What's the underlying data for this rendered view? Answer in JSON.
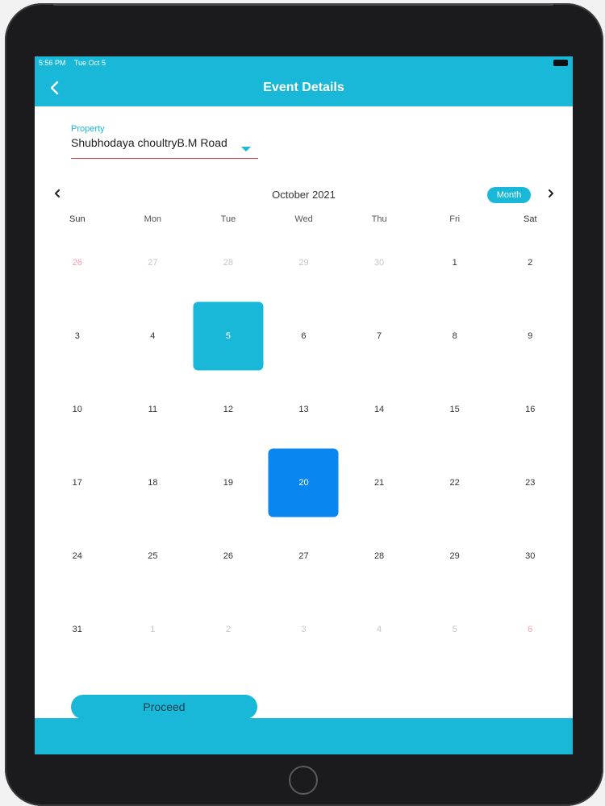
{
  "status_bar": {
    "time": "5:56 PM",
    "date": "Tue Oct 5"
  },
  "app_bar": {
    "title": "Event Details",
    "back_icon": "chevron-left-icon"
  },
  "property": {
    "label": "Property",
    "value": "Shubhodaya choultryB.M Road"
  },
  "calendar": {
    "month_label": "October 2021",
    "view_mode_label": "Month",
    "weekdays": [
      "Sun",
      "Mon",
      "Tue",
      "Wed",
      "Thu",
      "Fri",
      "Sat"
    ],
    "days": [
      {
        "d": "26",
        "outside": true,
        "red": true
      },
      {
        "d": "27",
        "outside": true
      },
      {
        "d": "28",
        "outside": true
      },
      {
        "d": "29",
        "outside": true
      },
      {
        "d": "30",
        "outside": true
      },
      {
        "d": "1"
      },
      {
        "d": "2"
      },
      {
        "d": "3"
      },
      {
        "d": "4"
      },
      {
        "d": "5",
        "today": true
      },
      {
        "d": "6"
      },
      {
        "d": "7"
      },
      {
        "d": "8"
      },
      {
        "d": "9"
      },
      {
        "d": "10"
      },
      {
        "d": "11"
      },
      {
        "d": "12"
      },
      {
        "d": "13"
      },
      {
        "d": "14"
      },
      {
        "d": "15"
      },
      {
        "d": "16"
      },
      {
        "d": "17"
      },
      {
        "d": "18"
      },
      {
        "d": "19"
      },
      {
        "d": "20",
        "selected": true
      },
      {
        "d": "21"
      },
      {
        "d": "22"
      },
      {
        "d": "23"
      },
      {
        "d": "24"
      },
      {
        "d": "25"
      },
      {
        "d": "26"
      },
      {
        "d": "27"
      },
      {
        "d": "28"
      },
      {
        "d": "29"
      },
      {
        "d": "30"
      },
      {
        "d": "31"
      },
      {
        "d": "1",
        "outside": true
      },
      {
        "d": "2",
        "outside": true
      },
      {
        "d": "3",
        "outside": true
      },
      {
        "d": "4",
        "outside": true
      },
      {
        "d": "5",
        "outside": true
      },
      {
        "d": "6",
        "outside": true,
        "red": true
      }
    ]
  },
  "proceed_label": "Proceed",
  "colors": {
    "accent": "#1ab8d8",
    "selected": "#0a86f0",
    "outside_day": "#c6c6c6",
    "outside_weekend": "#f4a0a8"
  }
}
